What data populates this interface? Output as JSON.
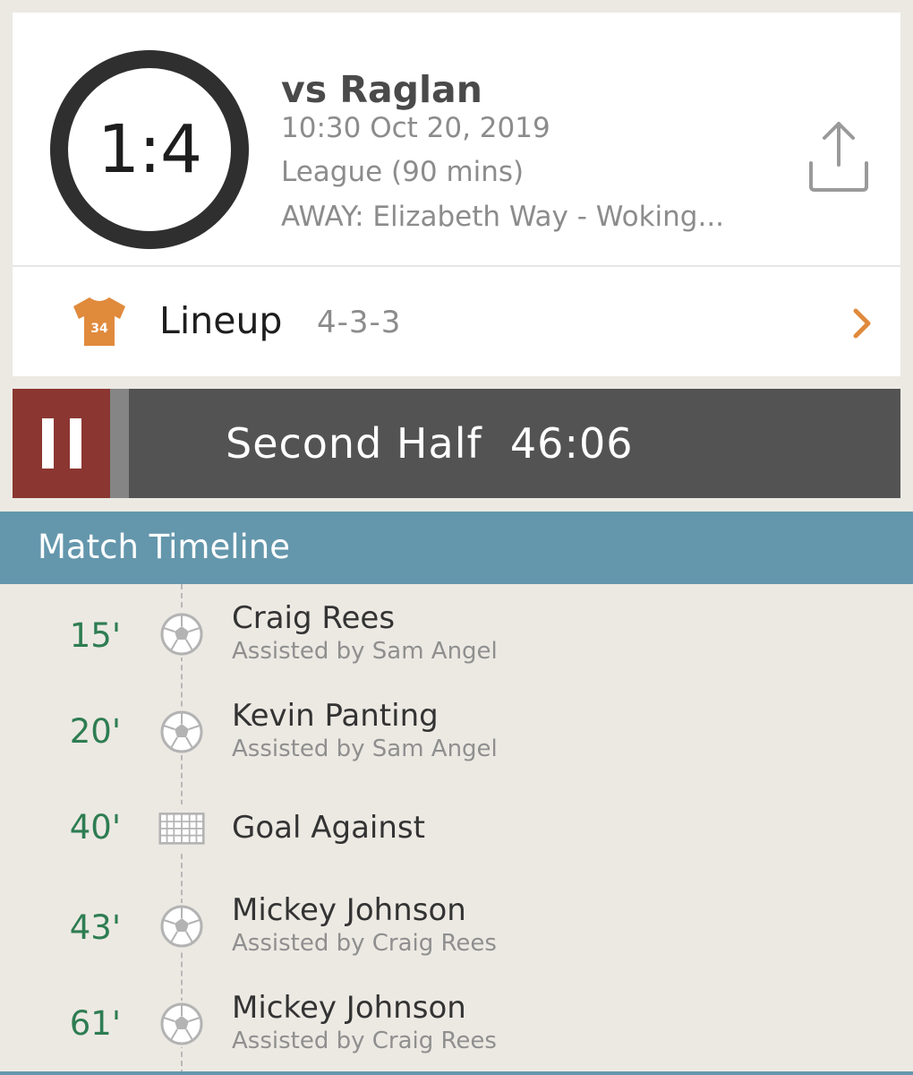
{
  "match": {
    "score": "1:4",
    "opponent": "vs Raglan",
    "datetime": "10:30 Oct 20, 2019",
    "type": "League (90 mins)",
    "venue": "AWAY: Elizabeth Way - Woking..."
  },
  "lineup": {
    "label": "Lineup",
    "formation": "4-3-3",
    "shirt_number": "34"
  },
  "timer": {
    "text": "Second Half  46:06"
  },
  "timeline": {
    "title": "Match Timeline",
    "events": [
      {
        "minute": "15'",
        "icon": "football-icon",
        "name": "Craig Rees",
        "assist": "Assisted by Sam Angel"
      },
      {
        "minute": "20'",
        "icon": "football-icon",
        "name": "Kevin Panting",
        "assist": "Assisted by Sam Angel"
      },
      {
        "minute": "40'",
        "icon": "goal-net-icon",
        "name": "Goal Against",
        "assist": ""
      },
      {
        "minute": "43'",
        "icon": "football-icon",
        "name": "Mickey Johnson",
        "assist": "Assisted by Craig Rees"
      },
      {
        "minute": "61'",
        "icon": "football-icon",
        "name": "Mickey Johnson",
        "assist": "Assisted by Craig Rees"
      }
    ]
  },
  "colors": {
    "accent": "#e08a3c",
    "pause_button": "#8b3631",
    "timeline_header": "#6497ac",
    "minute_text": "#2e7d52"
  }
}
